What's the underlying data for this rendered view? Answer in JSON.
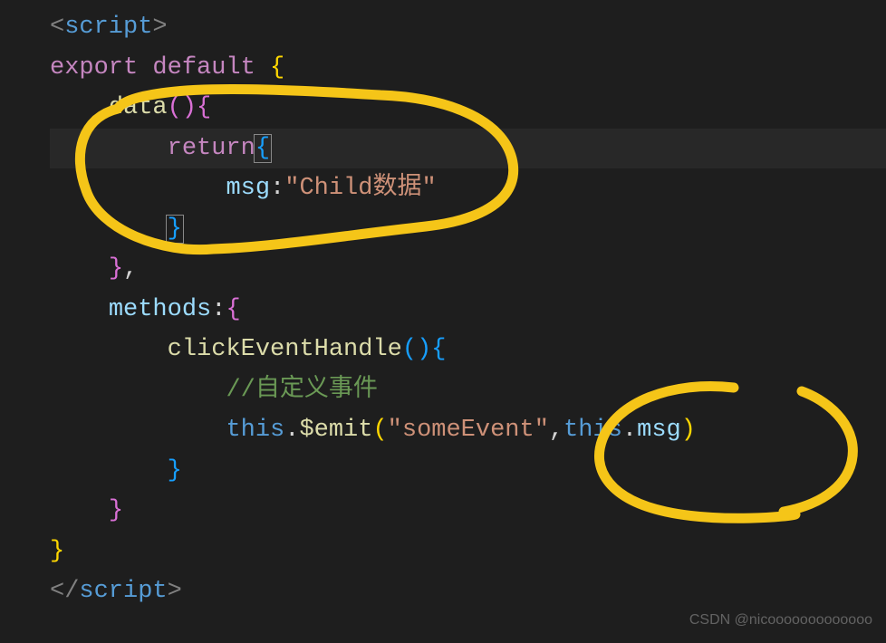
{
  "code": {
    "line1": {
      "lt": "<",
      "tag": "script",
      "gt": ">"
    },
    "line2": {
      "export": "export",
      "default": "default",
      "brace": " {"
    },
    "line3": {
      "func": "data",
      "parens": "()",
      "brace": "{"
    },
    "line4": {
      "return": "return",
      "brace": "{"
    },
    "line5": {
      "prop": "msg",
      "colon": ":",
      "string": "\"Child数据\""
    },
    "line6": {
      "brace": "}"
    },
    "line7": {
      "brace": "}",
      "comma": ","
    },
    "line8": {
      "prop": "methods",
      "colon": ":",
      "brace": "{"
    },
    "line9": {
      "func": "clickEventHandle",
      "parens": "()",
      "brace": "{"
    },
    "line10": {
      "comment": "//自定义事件"
    },
    "line11": {
      "this": "this",
      "dot1": ".",
      "emit": "$emit",
      "lparen": "(",
      "string": "\"someEvent\"",
      "comma": ",",
      "this2": "this",
      "dot2": ".",
      "msg": "msg",
      "rparen": ")"
    },
    "line12": {
      "brace": "}"
    },
    "line13": {
      "brace": "}"
    },
    "line14": {
      "brace": "}"
    },
    "line15": {
      "lt": "</",
      "tag": "script",
      "gt": ">"
    }
  },
  "watermark": "CSDN @nicooooooooooooo",
  "annotations": {
    "circle1_color": "#f5c518",
    "circle2_color": "#f5c518"
  }
}
